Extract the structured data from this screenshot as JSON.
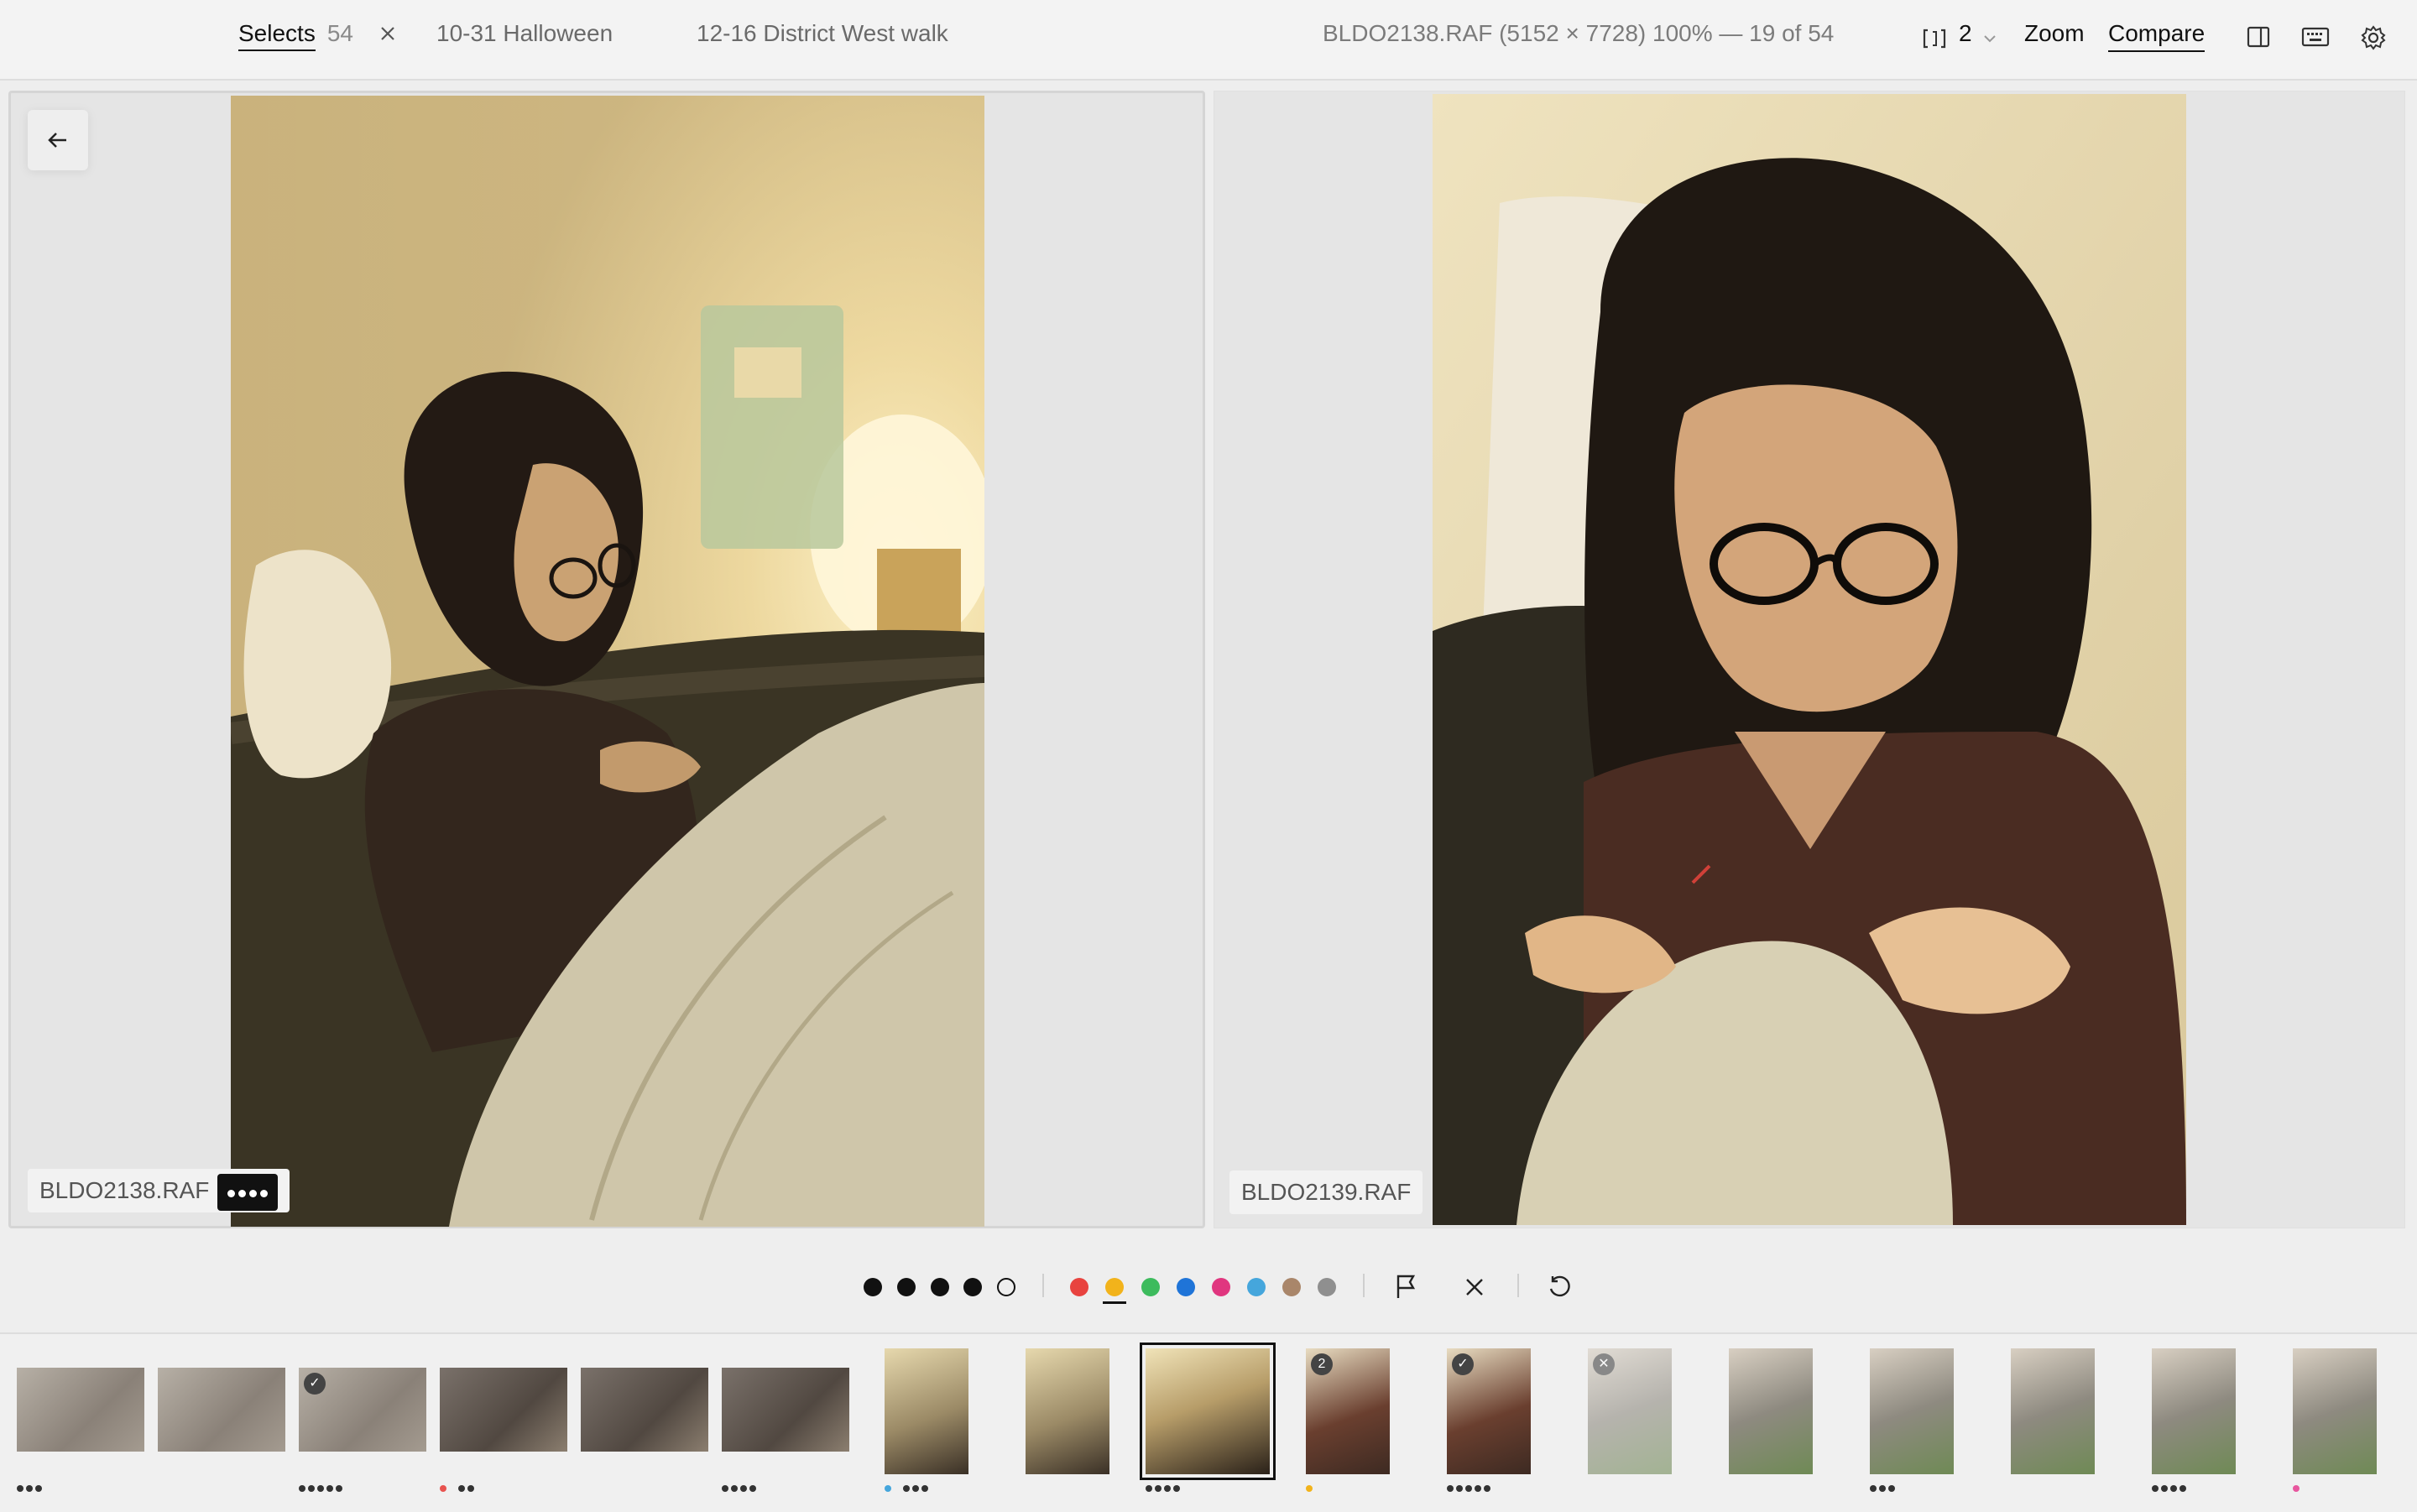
{
  "tabs": [
    {
      "name": "Selects",
      "count": "54"
    },
    {
      "name": "10-31 Halloween"
    },
    {
      "name": "12-16 District West walk"
    }
  ],
  "toolbar": {
    "file_info": "BLDO2138.RAF (5152 × 7728) 100% — 19 of 54",
    "grid_count": "2",
    "zoom_label": "Zoom",
    "compare_label": "Compare"
  },
  "panes": {
    "left": {
      "filename": "BLDO2138.RAF",
      "rating": 4
    },
    "right": {
      "filename": "BLDO2139.RAF"
    }
  },
  "rating_bar": {
    "stars_filled": 4,
    "stars_total": 5,
    "color_labels": [
      "#e8433f",
      "#f2b31b",
      "#3dbb5d",
      "#1f74d8",
      "#e0367f",
      "#45a6dc",
      "#a9866a",
      "#8f8f8f"
    ],
    "selected_color": "#f2b31b"
  },
  "filmstrip": [
    {
      "stars": 3,
      "color": ""
    },
    {
      "stars": 0,
      "color": ""
    },
    {
      "stars": 5,
      "color": "",
      "check": true
    },
    {
      "stars": 2,
      "color": "#e8534f"
    },
    {
      "stars": 0,
      "color": ""
    },
    {
      "stars": 4,
      "color": ""
    },
    {
      "stars": 3,
      "color": "#45a6dc"
    },
    {
      "stars": 0,
      "color": ""
    },
    {
      "stars": 4,
      "color": "",
      "selected": true
    },
    {
      "stars": 0,
      "color": "#f2b31b",
      "badge": "2"
    },
    {
      "stars": 5,
      "color": "",
      "check": true
    },
    {
      "stars": 0,
      "color": "",
      "reject": true
    },
    {
      "stars": 0,
      "color": ""
    },
    {
      "stars": 3,
      "color": ""
    },
    {
      "stars": 0,
      "color": ""
    },
    {
      "stars": 4,
      "color": ""
    },
    {
      "stars": 0,
      "color": "#e8569e"
    }
  ]
}
